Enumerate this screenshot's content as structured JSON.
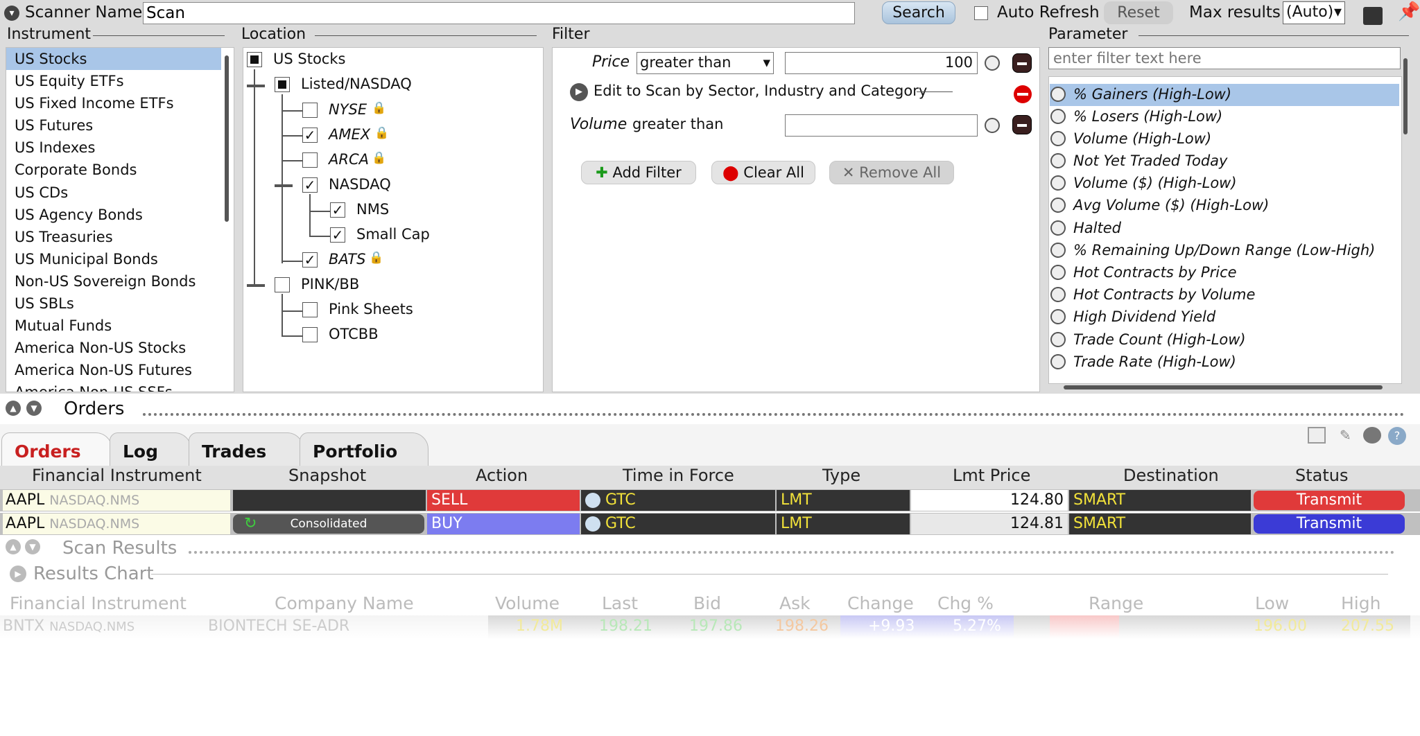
{
  "topbar": {
    "scanner_name_label": "Scanner Name:",
    "scanner_name_value": "Scan",
    "search_label": "Search",
    "auto_refresh_label": "Auto Refresh",
    "reset_label": "Reset",
    "max_results_label": "Max results",
    "max_results_value": "(Auto)"
  },
  "sections": {
    "instrument": "Instrument",
    "location": "Location",
    "filter": "Filter",
    "parameter": "Parameter"
  },
  "instruments": [
    "US Stocks",
    "US Equity ETFs",
    "US Fixed Income ETFs",
    "US Futures",
    "US Indexes",
    "Corporate Bonds",
    "US CDs",
    "US Agency Bonds",
    "US Treasuries",
    "US Municipal Bonds",
    "Non-US Sovereign Bonds",
    "US SBLs",
    "Mutual Funds",
    "America Non-US Stocks",
    "America Non-US Futures",
    "America Non-US SSFs"
  ],
  "location": {
    "us_stocks": "US Stocks",
    "listed": "Listed/NASDAQ",
    "nyse": "NYSE",
    "amex": "AMEX",
    "arca": "ARCA",
    "nasdaq": "NASDAQ",
    "nms": "NMS",
    "small_cap": "Small Cap",
    "bats": "BATS",
    "pink_bb": "PINK/BB",
    "pink_sheets": "Pink Sheets",
    "otcbb": "OTCBB"
  },
  "filter": {
    "price_label": "Price",
    "price_op": "greater than",
    "price_value": "100",
    "sector_label": "Edit to Scan by Sector, Industry and Category",
    "volume_label": "Volume",
    "volume_op": "greater than",
    "add_filter": "Add Filter",
    "clear_all": "Clear All",
    "remove_all": "Remove All"
  },
  "parameter": {
    "placeholder": "enter filter text here",
    "items": [
      "% Gainers (High-Low)",
      "% Losers (High-Low)",
      "Volume (High-Low)",
      "Not Yet Traded Today",
      "Volume ($) (High-Low)",
      "Avg Volume ($) (High-Low)",
      "Halted",
      "% Remaining Up/Down Range (Low-High)",
      "Hot Contracts by Price",
      "Hot Contracts by Volume",
      "High Dividend Yield",
      "Trade Count (High-Low)",
      "Trade Rate (High-Low)"
    ]
  },
  "orders": {
    "panel_title": "Orders",
    "tabs": [
      "Orders",
      "Log",
      "Trades",
      "Portfolio"
    ],
    "columns": [
      "Financial Instrument",
      "Snapshot",
      "Action",
      "Time in Force",
      "Type",
      "Lmt Price",
      "Destination",
      "Status"
    ],
    "rows": [
      {
        "symbol": "AAPL",
        "exchange": "NASDAQ.NMS",
        "snapshot": "",
        "action": "SELL",
        "tif": "GTC",
        "type": "LMT",
        "lmt": "124.80",
        "dest": "SMART",
        "status": "Transmit"
      },
      {
        "symbol": "AAPL",
        "exchange": "NASDAQ.NMS",
        "snapshot": "Consolidated",
        "action": "BUY",
        "tif": "GTC",
        "type": "LMT",
        "lmt": "124.81",
        "dest": "SMART",
        "status": "Transmit"
      }
    ]
  },
  "scan": {
    "title": "Scan Results",
    "chart_title": "Results Chart",
    "columns": [
      "Financial Instrument",
      "Company Name",
      "Volume",
      "Last",
      "Bid",
      "Ask",
      "Change",
      "Chg %",
      "Range",
      "Low",
      "High"
    ],
    "row": {
      "symbol": "BNTX",
      "exchange": "NASDAQ.NMS",
      "company": "BIONTECH SE-ADR",
      "volume": "1.78M",
      "last": "198.21",
      "bid": "197.86",
      "ask": "198.26",
      "change": "+9.93",
      "chg_pct": "5.27%",
      "low": "196.00",
      "high": "207.55"
    }
  },
  "colors": {
    "sell": "#e03a3a",
    "buy": "#7c7cf0",
    "selected": "#a9c6e8",
    "accent_yellow": "#f2e23a"
  }
}
